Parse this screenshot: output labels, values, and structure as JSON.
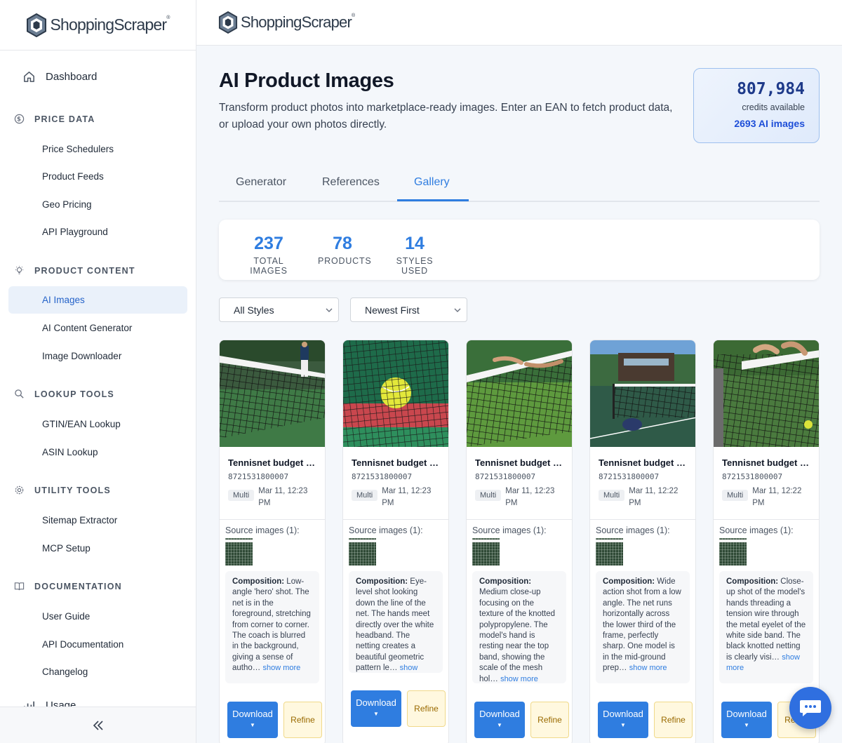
{
  "brand": {
    "name": "ShoppingScraper",
    "tm": "®"
  },
  "sidebar": {
    "dashboard": "Dashboard",
    "sections": [
      {
        "title": "PRICE DATA",
        "icon": "dollar-circle-icon",
        "items": [
          "Price Schedulers",
          "Product Feeds",
          "Geo Pricing",
          "API Playground"
        ]
      },
      {
        "title": "PRODUCT CONTENT",
        "icon": "lightbulb-icon",
        "items": [
          "AI Images",
          "AI Content Generator",
          "Image Downloader"
        ]
      },
      {
        "title": "LOOKUP TOOLS",
        "icon": "search-icon",
        "items": [
          "GTIN/EAN Lookup",
          "ASIN Lookup"
        ]
      },
      {
        "title": "UTILITY TOOLS",
        "icon": "gear-icon",
        "items": [
          "Sitemap Extractor",
          "MCP Setup"
        ]
      },
      {
        "title": "DOCUMENTATION",
        "icon": "book-icon",
        "items": [
          "User Guide",
          "API Documentation",
          "Changelog"
        ]
      }
    ],
    "partial_item": "Usage",
    "active_item": "AI Images"
  },
  "page": {
    "title": "AI Product Images",
    "description": "Transform product photos into marketplace-ready images. Enter an EAN to fetch product data, or upload your own photos directly."
  },
  "credits": {
    "value": "807,984",
    "label": "credits available",
    "ai_images": "2693 AI images"
  },
  "tabs": [
    "Generator",
    "References",
    "Gallery"
  ],
  "active_tab": "Gallery",
  "stats": [
    {
      "value": "237",
      "label": "TOTAL IMAGES"
    },
    {
      "value": "78",
      "label": "PRODUCTS"
    },
    {
      "value": "14",
      "label": "STYLES USED"
    }
  ],
  "filters": {
    "style": "All Styles",
    "sort": "Newest First"
  },
  "cards": [
    {
      "title": "Tennisnet budget …",
      "ean": "8721531800007",
      "badge": "Multi",
      "date": "Mar 11, 12:23 PM",
      "source_label": "Source images (1):",
      "comp_label": "Composition:",
      "comp_text": " Low-angle 'hero' shot. The net is in the foreground, stretching from corner to corner. The coach is blurred in the background, giving a sense of autho…",
      "more": "show more",
      "download": "Download",
      "refine": "Refine"
    },
    {
      "title": "Tennisnet budget …",
      "ean": "8721531800007",
      "badge": "Multi",
      "date": "Mar 11, 12:23 PM",
      "source_label": "Source images (1):",
      "comp_label": "Composition:",
      "comp_text": " Eye-level shot looking down the line of the net. The hands meet directly over the white headband. The netting creates a beautiful geometric pattern le…",
      "more": "show more",
      "download": "Download",
      "refine": "Refine"
    },
    {
      "title": "Tennisnet budget …",
      "ean": "8721531800007",
      "badge": "Multi",
      "date": "Mar 11, 12:23 PM",
      "source_label": "Source images (1):",
      "comp_label": "Composition:",
      "comp_text": " Medium close-up focusing on the texture of the knotted polypropylene. The model's hand is resting near the top band, showing the scale of the mesh hol…",
      "more": "show more",
      "download": "Download",
      "refine": "Refine"
    },
    {
      "title": "Tennisnet budget …",
      "ean": "8721531800007",
      "badge": "Multi",
      "date": "Mar 11, 12:22 PM",
      "source_label": "Source images (1):",
      "comp_label": "Composition:",
      "comp_text": " Wide action shot from a low angle. The net runs horizontally across the lower third of the frame, perfectly sharp. One model is in the mid-ground prep…",
      "more": "show more",
      "download": "Download",
      "refine": "Refine"
    },
    {
      "title": "Tennisnet budget …",
      "ean": "8721531800007",
      "badge": "Multi",
      "date": "Mar 11, 12:22 PM",
      "source_label": "Source images (1):",
      "comp_label": "Composition:",
      "comp_text": " Close-up shot of the model's hands threading a tension wire through the metal eyelet of the white side band. The black knotted netting is clearly visi…",
      "more": "show more",
      "download": "Download",
      "refine": "Refine"
    }
  ]
}
